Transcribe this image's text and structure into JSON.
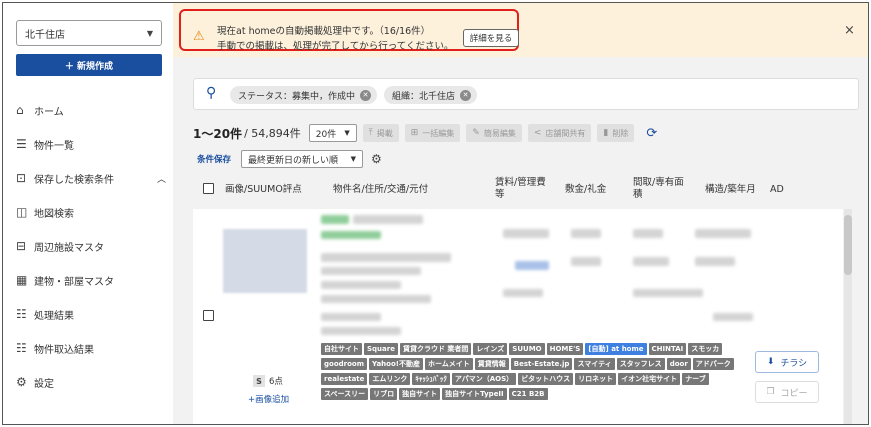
{
  "sidebar": {
    "branch": "北千住店",
    "new_button": "＋ 新規作成",
    "items": [
      {
        "icon": "home-icon",
        "glyph": "⌂",
        "label": "ホーム"
      },
      {
        "icon": "list-icon",
        "glyph": "☰",
        "label": "物件一覧"
      },
      {
        "icon": "saved-search-icon",
        "glyph": "⊡",
        "label": "保存した検索条件"
      },
      {
        "icon": "map-search-icon",
        "glyph": "◫",
        "label": "地図検索"
      },
      {
        "icon": "facility-icon",
        "glyph": "⊟",
        "label": "周辺施設マスタ"
      },
      {
        "icon": "building-icon",
        "glyph": "▦",
        "label": "建物・部屋マスタ"
      },
      {
        "icon": "result-icon",
        "glyph": "☷",
        "label": "処理結果"
      },
      {
        "icon": "import-result-icon",
        "glyph": "☷",
        "label": "物件取込結果"
      },
      {
        "icon": "settings-icon",
        "glyph": "⚙",
        "label": "設定"
      }
    ]
  },
  "banner": {
    "line1": "現在at homeの自動掲載処理中です。（16/16件）",
    "line2": "手動での掲載は、処理が完了してから行ってください。",
    "detail_button": "詳細を見る",
    "close": "×",
    "warn_color": "#e38a16",
    "border_color": "#e0201b"
  },
  "search": {
    "chips": [
      "ステータス：募集中，作成中",
      "組織：北千住店"
    ]
  },
  "toolbar": {
    "range": "1〜20件",
    "total": " / 54,894件",
    "per_page": "20件",
    "tools": [
      {
        "icon": "publish-icon",
        "glyph": "⤒",
        "label": "掲載"
      },
      {
        "icon": "bulk-edit-icon",
        "glyph": "⊞",
        "label": "一括編集"
      },
      {
        "icon": "simple-edit-icon",
        "glyph": "✎",
        "label": "簡易編集"
      },
      {
        "icon": "share-icon",
        "glyph": "<",
        "label": "店舗間共有"
      },
      {
        "icon": "trash-icon",
        "glyph": "▮",
        "label": "削除"
      }
    ],
    "refresh": "⟳"
  },
  "sort": {
    "save_condition": "条件保存",
    "order": "最終更新日の新しい順"
  },
  "columns": {
    "image": "画像/SUUMO評点",
    "name": "物件名/住所/交通/元付",
    "rent": "賃料/管理費等",
    "deposit": "敷金/礼金",
    "layout": "間取/専有面積",
    "structure": "構造/築年月",
    "ad": "AD"
  },
  "row": {
    "suumo_badge": "S",
    "suumo_score": "6点",
    "add_image": "+画像追加",
    "tags": [
      "自社サイト",
      "Square",
      "賃貸クラウド 業者間",
      "レインズ",
      "SUUMO",
      "HOME'S",
      "[自動] at home",
      "CHINTAI",
      "スモッカ",
      "goodroom",
      "Yahoo!不動産",
      "ホームメイト",
      "賃貸情報",
      "Best-Estate.jp",
      "スマイティ",
      "スタッフレス",
      "door",
      "アドパーク",
      "realestate",
      "エムリンク",
      "ｷｬｯｼｭﾊﾞｯｸ",
      "アパマン（AOS）",
      "ビタットハウス",
      "リロネット",
      "イオン社宅サイト",
      "ナーブ",
      "スペースリー",
      "リブロ",
      "独自サイト",
      "独自サイトTypeII",
      "C21 B2B"
    ],
    "active_tag": "[自動] at home",
    "flyer_button": "チラシ",
    "copy_button": "コピー",
    "accent_color": "#3f7fe0"
  }
}
